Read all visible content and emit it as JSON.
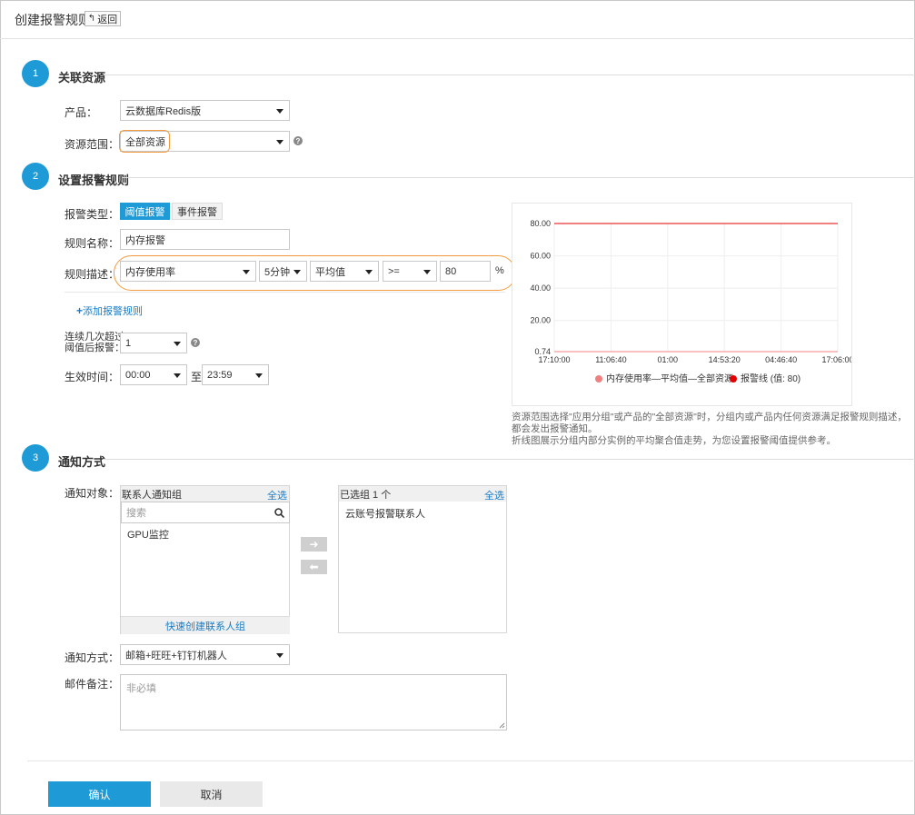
{
  "header": {
    "title": "创建报警规则",
    "back_label": "返回"
  },
  "section1": {
    "step": "1",
    "title": "关联资源",
    "product_label": "产品：",
    "product_value": "云数据库Redis版",
    "scope_label": "资源范围：",
    "scope_value": "全部资源"
  },
  "section2": {
    "step": "2",
    "title": "设置报警规则",
    "type_label": "报警类型：",
    "type_tabs": [
      "阈值报警",
      "事件报警"
    ],
    "name_label": "规则名称：",
    "name_value": "内存报警",
    "desc_label": "规则描述：",
    "metric_value": "内存使用率",
    "period_value": "5分钟",
    "stat_value": "平均值",
    "operator_value": ">=",
    "threshold_value": "80",
    "unit": "%",
    "add_rule_label": "添加报警规则",
    "times_label_line1": "连续几次超过",
    "times_label_line2": "阈值后报警：",
    "times_value": "1",
    "effective_label": "生效时间：",
    "start_time": "00:00",
    "to_label": "至",
    "end_time": "23:59",
    "note_line1": "资源范围选择\"应用分组\"或产品的\"全部资源\"时，分组内或产品内任何资源满足报警规则描述，",
    "note_line2": "都会发出报警通知。",
    "note_line3": "折线图展示分组内部分实例的平均聚合值走势，为您设置报警阈值提供参考。"
  },
  "chart_data": {
    "type": "line",
    "x": [
      "17:10:00",
      "11:06:40",
      "01:00",
      "14:53:20",
      "04:46:40",
      "17:06:00"
    ],
    "y_ticks": [
      "80.00",
      "60.00",
      "40.00",
      "20.00",
      "0.74"
    ],
    "ylim": [
      0.74,
      80
    ],
    "series": [
      {
        "name": "内存使用率—平均值—全部资源",
        "color": "#f08080",
        "values": [
          0.74,
          0.74,
          0.74,
          0.74,
          0.74,
          0.74
        ]
      },
      {
        "name": "报警线 (值: 80)",
        "color": "#e00000",
        "values": [
          80,
          80,
          80,
          80,
          80,
          80
        ]
      }
    ],
    "grid": true,
    "legend": "bottom"
  },
  "section3": {
    "step": "3",
    "title": "通知方式",
    "target_label": "通知对象：",
    "left_panel_title": "联系人通知组",
    "select_all": "全选",
    "search_placeholder": "搜索",
    "left_items": [
      "GPU监控"
    ],
    "quick_create": "快速创建联系人组",
    "right_panel_title": "已选组 1 个",
    "right_items": [
      "云账号报警联系人"
    ],
    "arrow_right": "➜",
    "arrow_left": "⬅",
    "method_label": "通知方式：",
    "method_value": "邮箱+旺旺+钉钉机器人",
    "remark_label": "邮件备注：",
    "remark_placeholder": "非必填"
  },
  "footer": {
    "confirm": "确认",
    "cancel": "取消"
  }
}
